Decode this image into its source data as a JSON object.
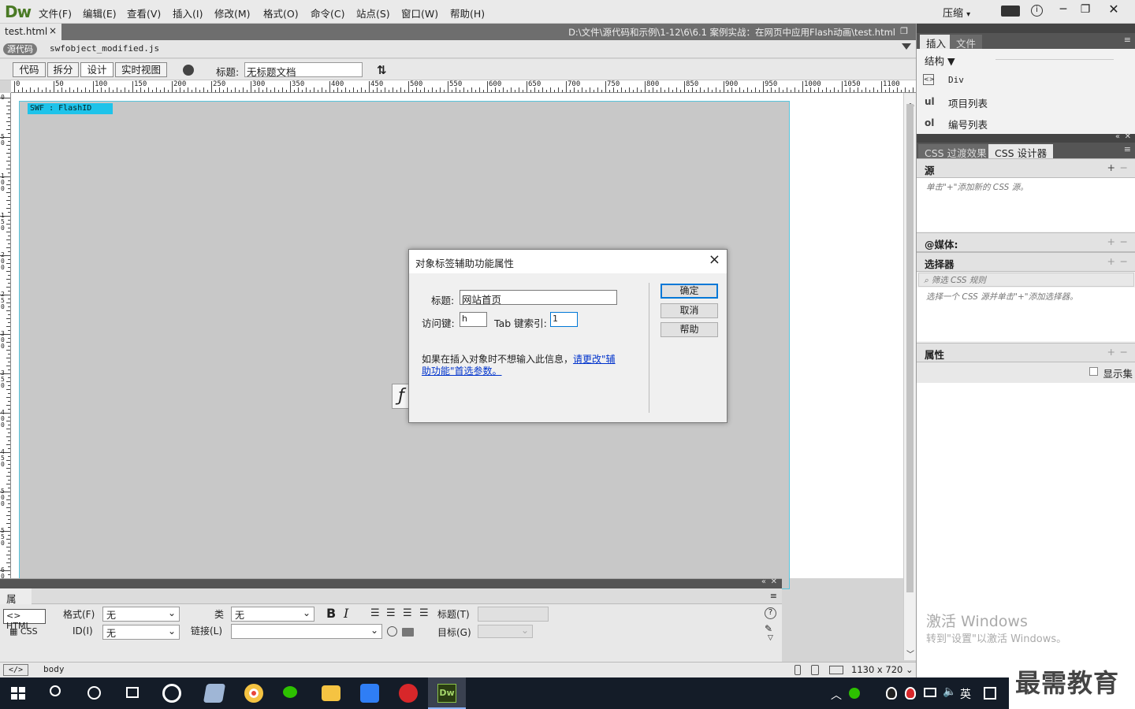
{
  "app": {
    "logo": "Dw",
    "compress_label": "压缩",
    "compress_arrow": "▾"
  },
  "menu": [
    "文件(F)",
    "编辑(E)",
    "查看(V)",
    "插入(I)",
    "修改(M)",
    "格式(O)",
    "命令(C)",
    "站点(S)",
    "窗口(W)",
    "帮助(H)"
  ],
  "document": {
    "tab_name": "test.html",
    "tab_close": "×",
    "path": "D:\\文件\\源代码和示例\\1-12\\6\\6.1  案例实战：在网页中应用Flash动画\\test.html",
    "source_label": "源代码",
    "related_file": "swfobject_modified.js",
    "views": [
      "代码",
      "拆分",
      "设计",
      "实时视图"
    ],
    "active_view": "设计",
    "title_label": "标题:",
    "title_value": "无标题文档"
  },
  "ruler": {
    "h_ticks": [
      "0",
      "50",
      "100",
      "150",
      "200",
      "250",
      "300",
      "350",
      "400",
      "450",
      "500",
      "550",
      "600",
      "650",
      "700",
      "750",
      "800",
      "850",
      "900",
      "950",
      "1000",
      "1050",
      "1100"
    ],
    "v_ticks": [
      "0",
      "5\n0",
      "1\n0\n0",
      "1\n5\n0",
      "2\n0\n0",
      "2\n5\n0",
      "3\n0\n0",
      "3\n5\n0",
      "4\n0\n0",
      "4\n5\n0",
      "5\n0\n0",
      "5\n5\n0",
      "6\n0\n0",
      "6\n5\n0",
      "7\n0"
    ]
  },
  "swf": {
    "label": "SWF : FlashID"
  },
  "dialog": {
    "title": "对象标签辅助功能属性",
    "close": "×",
    "title_field_label": "标题:",
    "title_field_value": "网站首页",
    "access_key_label": "访问键:",
    "access_key_value": "h",
    "tab_index_label": "Tab 键索引:",
    "tab_index_value": "1",
    "info_text": "如果在插入对象时不想输入此信息，",
    "link_text_1": "请更改\"辅",
    "link_text_2": "助功能\"首选参数。",
    "ok": "确定",
    "cancel": "取消",
    "help": "帮助"
  },
  "properties": {
    "tab": "属性",
    "html_btn": "HTML",
    "css_btn": "CSS",
    "format_label": "格式(F)",
    "format_value": "无",
    "id_label": "ID(I)",
    "id_value": "无",
    "class_label": "类",
    "class_value": "无",
    "link_label": "链接(L)",
    "link_value": "",
    "bold": "B",
    "italic": "I",
    "heading_label": "标题(T)",
    "target_label": "目标(G)"
  },
  "statusbar": {
    "tag": "body",
    "size": "1130 x 720"
  },
  "right_panel": {
    "tabs_top": [
      "插入",
      "文件"
    ],
    "structure_label": "结构",
    "insert_items": [
      {
        "icon": "<>",
        "label": "Div"
      },
      {
        "icon": "ul",
        "label": "项目列表"
      },
      {
        "icon": "ol",
        "label": "编号列表"
      }
    ],
    "tabs_css": [
      "CSS 过渡效果",
      "CSS 设计器"
    ],
    "sources_label": "源",
    "sources_hint": "单击\"+\"添加新的 CSS 源。",
    "media_label": "@媒体:",
    "selectors_label": "选择器",
    "filter_placeholder": "筛选 CSS 规则",
    "selectors_hint": "选择一个 CSS 源并单击\"+\"添加选择器。",
    "props_label": "属性",
    "show_set_label": "显示集",
    "activate_title": "激活 Windows",
    "activate_sub": "转到\"设置\"以激活 Windows。"
  },
  "taskbar": {
    "ime": "英",
    "watermark": "最需教育",
    "colors": {
      "chrome": "#e8453c",
      "wechat": "#2dc100",
      "explorer": "#f5c342",
      "wps": "#2f7ef5",
      "netease": "#d8272a",
      "dw": "#2a3d12"
    }
  }
}
